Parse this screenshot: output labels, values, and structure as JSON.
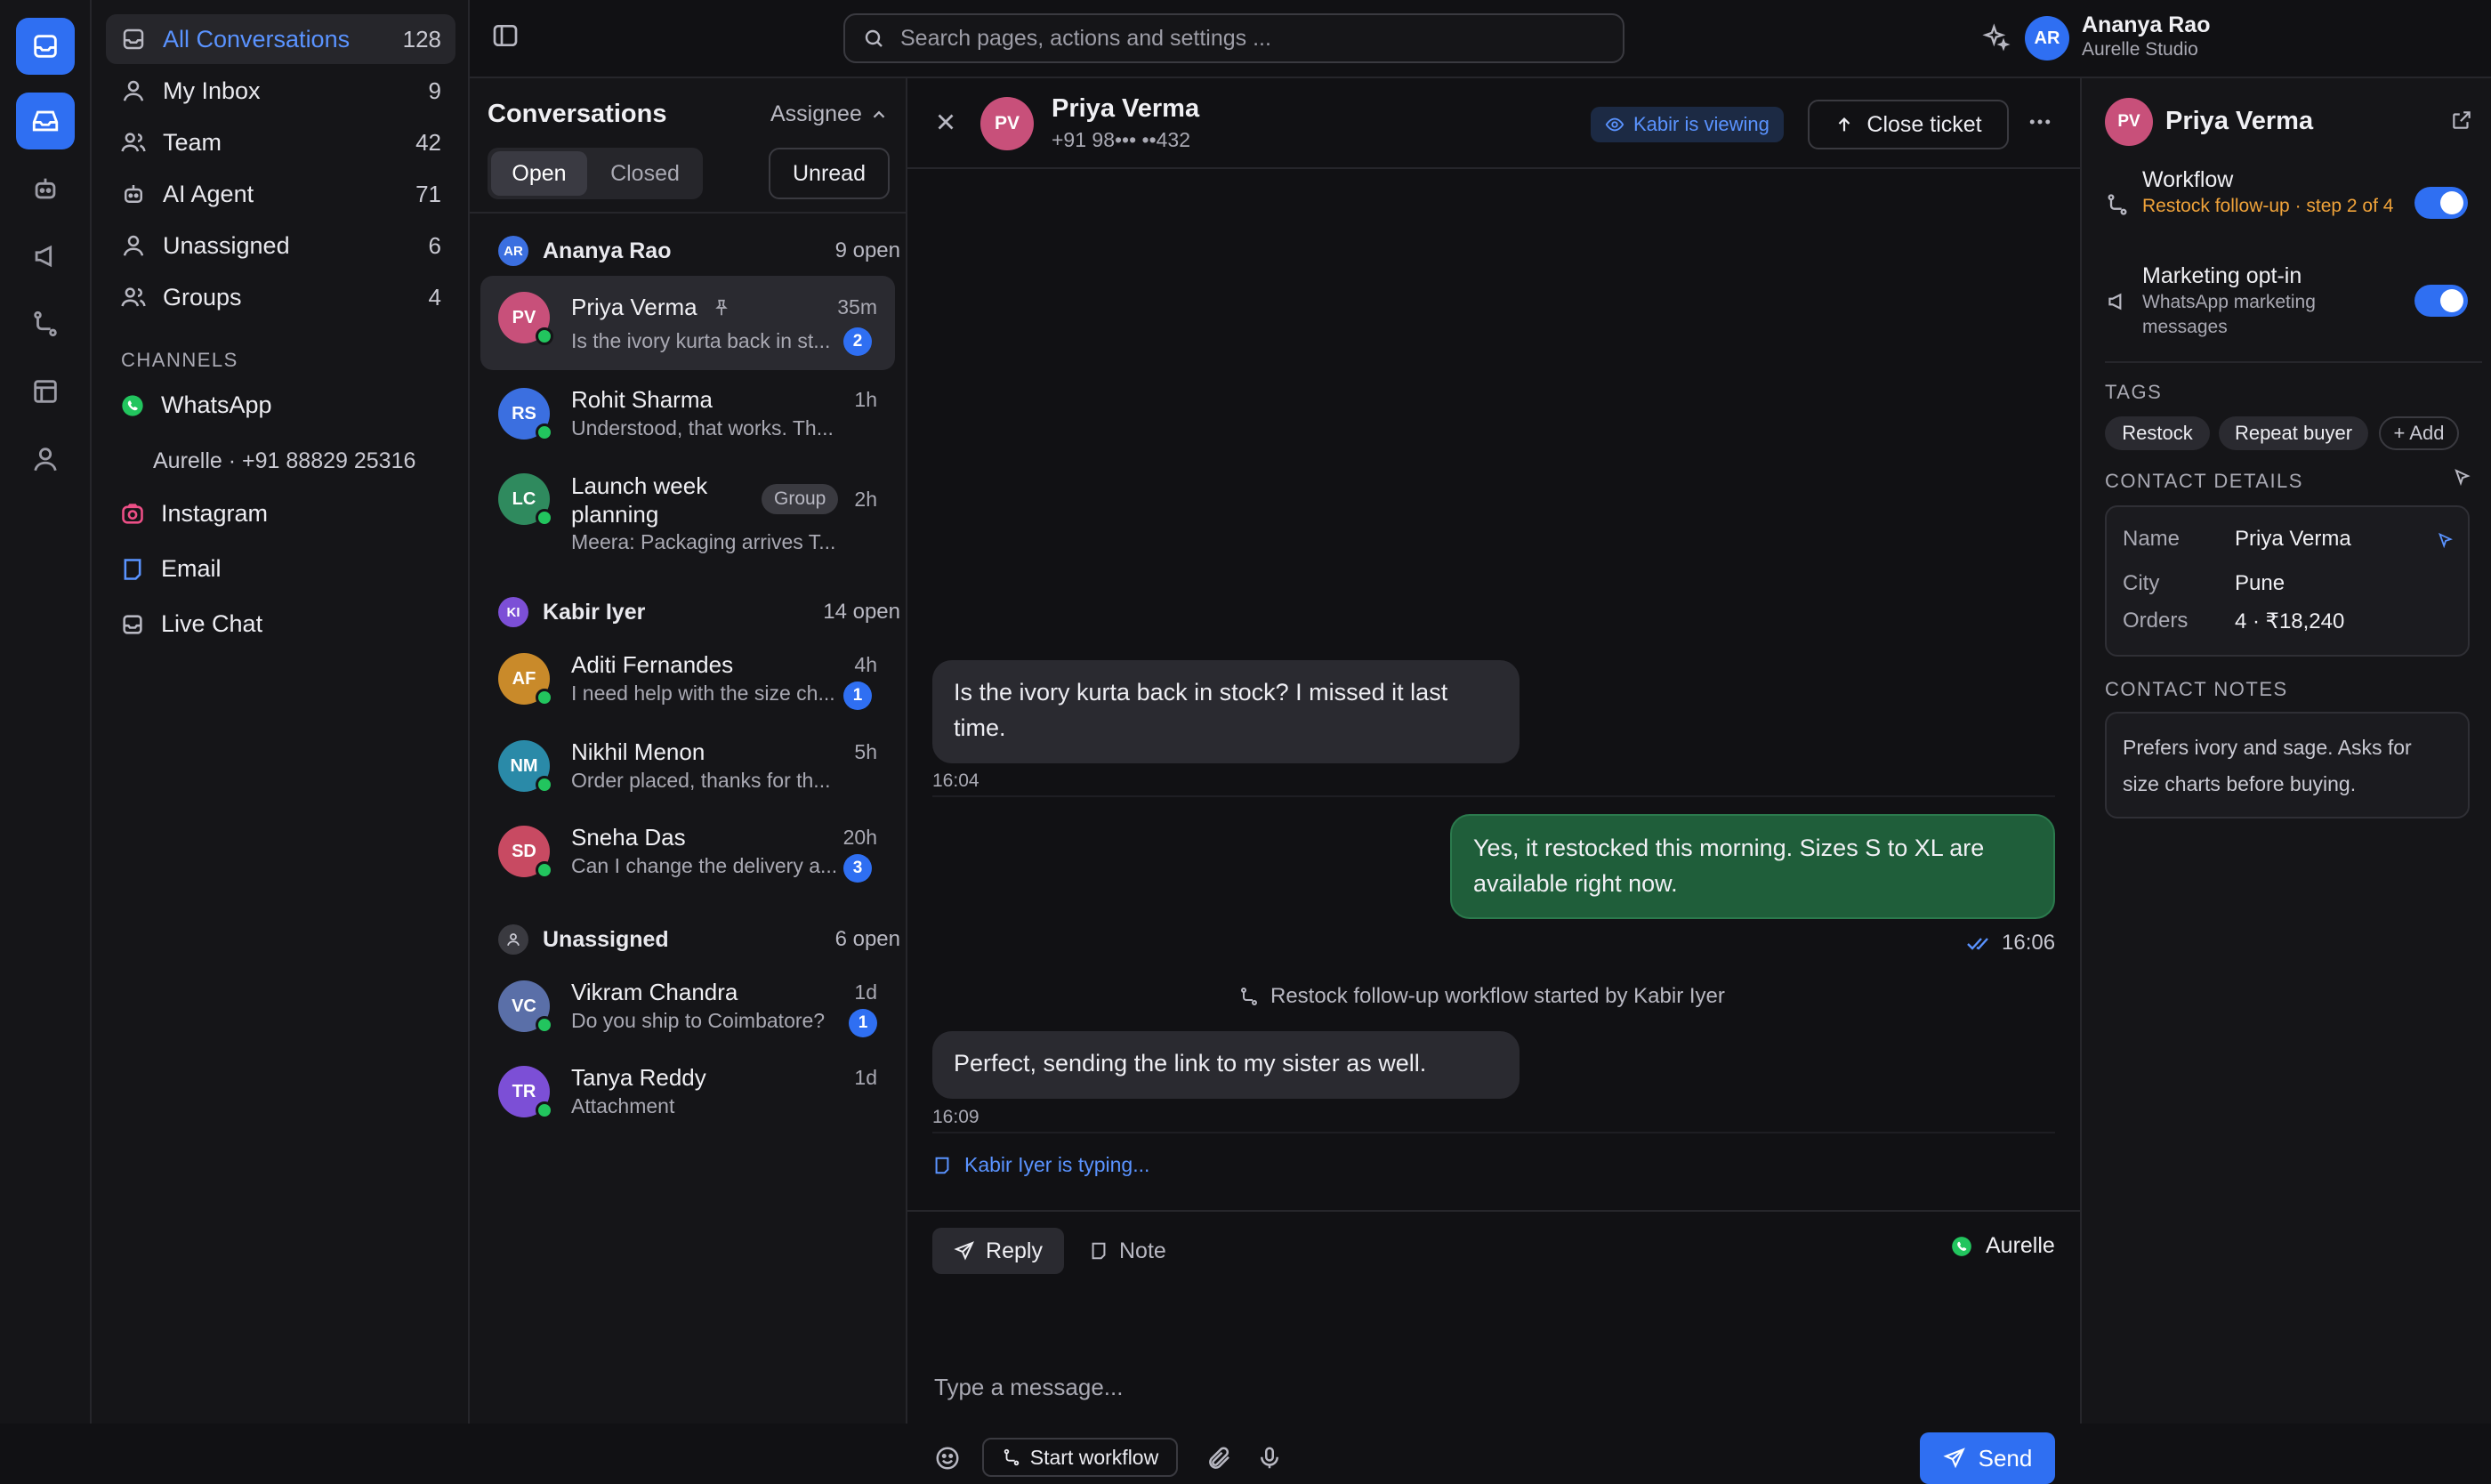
{
  "user": {
    "initials": "AR",
    "name": "Ananya Rao",
    "org": "Aurelle Studio"
  },
  "search": {
    "placeholder": "Search pages, actions and settings ..."
  },
  "rail": {
    "items": [
      {
        "icon": "inbox-icon",
        "active": true
      },
      {
        "icon": "inbox-tray-icon",
        "active": true
      },
      {
        "icon": "bot-icon",
        "active": false
      },
      {
        "icon": "megaphone-icon",
        "active": false
      },
      {
        "icon": "workflow-icon",
        "active": false
      },
      {
        "icon": "layout-icon",
        "active": false
      },
      {
        "icon": "user-icon",
        "active": false
      }
    ]
  },
  "nav": {
    "items": [
      {
        "label": "All Conversations",
        "count": "128",
        "icon": "inbox-icon"
      },
      {
        "label": "My Inbox",
        "count": "9",
        "icon": "user-icon"
      },
      {
        "label": "Team",
        "count": "42",
        "icon": "users-icon"
      },
      {
        "label": "AI Agent",
        "count": "71",
        "icon": "bot-icon"
      },
      {
        "label": "Unassigned",
        "count": "6",
        "icon": "user-icon"
      },
      {
        "label": "Groups",
        "count": "4",
        "icon": "users-icon"
      }
    ],
    "channels_label": "CHANNELS",
    "channels": [
      {
        "label": "WhatsApp",
        "icon": "whatsapp-icon",
        "color": "#22c55e"
      },
      {
        "label": "Aurelle · +91 88829 25316",
        "icon": "",
        "color": ""
      },
      {
        "label": "Instagram",
        "icon": "instagram-icon",
        "color": "#ec4f86"
      },
      {
        "label": "Email",
        "icon": "email-icon",
        "color": "#5a93ff"
      },
      {
        "label": "Live Chat",
        "icon": "livechat-icon",
        "color": "#b8b8c2"
      }
    ]
  },
  "list": {
    "title": "Conversations",
    "assignee": "Assignee",
    "tabs": {
      "open": "Open",
      "closed": "Closed"
    },
    "unread": "Unread",
    "groups": [
      {
        "initials": "AR",
        "name": "Ananya Rao",
        "count": "9 open",
        "color": "#3b6fe0"
      },
      {
        "initials": "KI",
        "name": "Kabir Iyer",
        "count": "14 open",
        "color": "#7c4fd6"
      },
      {
        "initials": "",
        "name": "Unassigned",
        "count": "6 open",
        "color": "#3a3a40"
      }
    ],
    "conversations": [
      {
        "initials": "PV",
        "name": "Priya Verma",
        "time": "35m",
        "preview": "Is the ivory kurta back in st...",
        "unread": "2",
        "color": "#c8507a"
      },
      {
        "initials": "RS",
        "name": "Rohit Sharma",
        "time": "1h",
        "preview": "Understood, that works. Th...",
        "unread": "",
        "color": "#3b6fe0"
      },
      {
        "initials": "LC",
        "name": "Launch week planning",
        "time": "2h",
        "preview": "Meera: Packaging arrives T...",
        "unread": "",
        "color": "#2f8a5e",
        "tag": "Group"
      },
      {
        "initials": "AF",
        "name": "Aditi Fernandes",
        "time": "4h",
        "preview": "I need help with the size ch...",
        "unread": "1",
        "color": "#c98a2a"
      },
      {
        "initials": "NM",
        "name": "Nikhil Menon",
        "time": "5h",
        "preview": "Order placed, thanks for th...",
        "unread": "",
        "color": "#2a8aa8"
      },
      {
        "initials": "SD",
        "name": "Sneha Das",
        "time": "20h",
        "preview": "Can I change the delivery a...",
        "unread": "3",
        "color": "#c84a62"
      },
      {
        "initials": "VC",
        "name": "Vikram Chandra",
        "time": "1d",
        "preview": "Do you ship to Coimbatore?",
        "unread": "1",
        "color": "#5a6fa8"
      },
      {
        "initials": "TR",
        "name": "Tanya Reddy",
        "time": "1d",
        "preview": "Attachment",
        "unread": "",
        "color": "#7c4fd6"
      }
    ]
  },
  "chat": {
    "contact": {
      "initials": "PV",
      "name": "Priya Verma",
      "phone": "+91 98••• ••432"
    },
    "viewing": "Kabir is viewing",
    "close_ticket": "Close ticket",
    "messages": [
      {
        "text": "Is the ivory kurta back in stock? I missed it last time.",
        "time": "16:04",
        "dir": "in"
      },
      {
        "text": "Yes, it restocked this morning. Sizes S to XL are available right now.",
        "time": "16:06",
        "dir": "out"
      },
      {
        "text": "Perfect, sending the link to my sister as well.",
        "time": "16:09",
        "dir": "in"
      }
    ],
    "system": "Restock follow-up workflow started by Kabir Iyer",
    "typing": "Kabir Iyer is typing...",
    "composer": {
      "reply": "Reply",
      "note": "Note",
      "channel": "Aurelle",
      "placeholder": "Type a message...",
      "start_workflow": "Start workflow",
      "send": "Send"
    }
  },
  "side": {
    "name": "Priya Verma",
    "initials": "PV",
    "workflow": {
      "label": "Workflow",
      "sub": "Restock follow-up · step 2 of 4",
      "on": true
    },
    "marketing": {
      "label": "Marketing opt-in",
      "sub": "WhatsApp marketing messages",
      "on": true
    },
    "tags_label": "TAGS",
    "tags": [
      "Restock",
      "Repeat buyer",
      "+ Add"
    ],
    "details_label": "CONTACT DETAILS",
    "details": [
      {
        "k": "Name",
        "v": "Priya Verma"
      },
      {
        "k": "City",
        "v": "Pune"
      },
      {
        "k": "Orders",
        "v": "4 · ₹18,240"
      }
    ],
    "notes_label": "CONTACT NOTES",
    "notes": "Prefers ivory and sage. Asks for size charts before buying."
  }
}
